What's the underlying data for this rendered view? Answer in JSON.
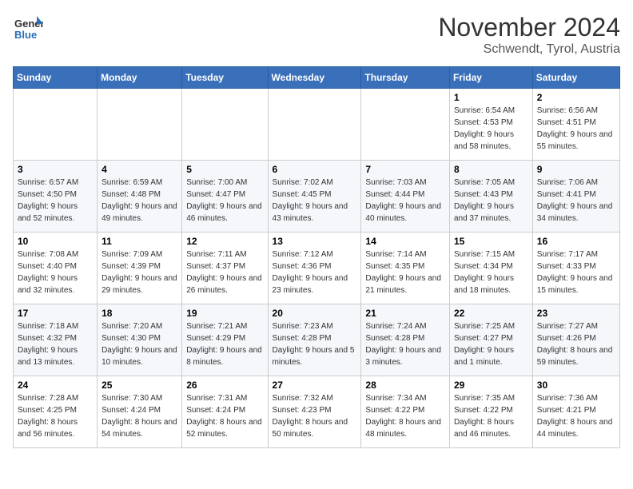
{
  "logo": {
    "general": "General",
    "blue": "Blue"
  },
  "header": {
    "month": "November 2024",
    "location": "Schwendt, Tyrol, Austria"
  },
  "weekdays": [
    "Sunday",
    "Monday",
    "Tuesday",
    "Wednesday",
    "Thursday",
    "Friday",
    "Saturday"
  ],
  "weeks": [
    [
      {
        "day": "",
        "info": ""
      },
      {
        "day": "",
        "info": ""
      },
      {
        "day": "",
        "info": ""
      },
      {
        "day": "",
        "info": ""
      },
      {
        "day": "",
        "info": ""
      },
      {
        "day": "1",
        "info": "Sunrise: 6:54 AM\nSunset: 4:53 PM\nDaylight: 9 hours and 58 minutes."
      },
      {
        "day": "2",
        "info": "Sunrise: 6:56 AM\nSunset: 4:51 PM\nDaylight: 9 hours and 55 minutes."
      }
    ],
    [
      {
        "day": "3",
        "info": "Sunrise: 6:57 AM\nSunset: 4:50 PM\nDaylight: 9 hours and 52 minutes."
      },
      {
        "day": "4",
        "info": "Sunrise: 6:59 AM\nSunset: 4:48 PM\nDaylight: 9 hours and 49 minutes."
      },
      {
        "day": "5",
        "info": "Sunrise: 7:00 AM\nSunset: 4:47 PM\nDaylight: 9 hours and 46 minutes."
      },
      {
        "day": "6",
        "info": "Sunrise: 7:02 AM\nSunset: 4:45 PM\nDaylight: 9 hours and 43 minutes."
      },
      {
        "day": "7",
        "info": "Sunrise: 7:03 AM\nSunset: 4:44 PM\nDaylight: 9 hours and 40 minutes."
      },
      {
        "day": "8",
        "info": "Sunrise: 7:05 AM\nSunset: 4:43 PM\nDaylight: 9 hours and 37 minutes."
      },
      {
        "day": "9",
        "info": "Sunrise: 7:06 AM\nSunset: 4:41 PM\nDaylight: 9 hours and 34 minutes."
      }
    ],
    [
      {
        "day": "10",
        "info": "Sunrise: 7:08 AM\nSunset: 4:40 PM\nDaylight: 9 hours and 32 minutes."
      },
      {
        "day": "11",
        "info": "Sunrise: 7:09 AM\nSunset: 4:39 PM\nDaylight: 9 hours and 29 minutes."
      },
      {
        "day": "12",
        "info": "Sunrise: 7:11 AM\nSunset: 4:37 PM\nDaylight: 9 hours and 26 minutes."
      },
      {
        "day": "13",
        "info": "Sunrise: 7:12 AM\nSunset: 4:36 PM\nDaylight: 9 hours and 23 minutes."
      },
      {
        "day": "14",
        "info": "Sunrise: 7:14 AM\nSunset: 4:35 PM\nDaylight: 9 hours and 21 minutes."
      },
      {
        "day": "15",
        "info": "Sunrise: 7:15 AM\nSunset: 4:34 PM\nDaylight: 9 hours and 18 minutes."
      },
      {
        "day": "16",
        "info": "Sunrise: 7:17 AM\nSunset: 4:33 PM\nDaylight: 9 hours and 15 minutes."
      }
    ],
    [
      {
        "day": "17",
        "info": "Sunrise: 7:18 AM\nSunset: 4:32 PM\nDaylight: 9 hours and 13 minutes."
      },
      {
        "day": "18",
        "info": "Sunrise: 7:20 AM\nSunset: 4:30 PM\nDaylight: 9 hours and 10 minutes."
      },
      {
        "day": "19",
        "info": "Sunrise: 7:21 AM\nSunset: 4:29 PM\nDaylight: 9 hours and 8 minutes."
      },
      {
        "day": "20",
        "info": "Sunrise: 7:23 AM\nSunset: 4:28 PM\nDaylight: 9 hours and 5 minutes."
      },
      {
        "day": "21",
        "info": "Sunrise: 7:24 AM\nSunset: 4:28 PM\nDaylight: 9 hours and 3 minutes."
      },
      {
        "day": "22",
        "info": "Sunrise: 7:25 AM\nSunset: 4:27 PM\nDaylight: 9 hours and 1 minute."
      },
      {
        "day": "23",
        "info": "Sunrise: 7:27 AM\nSunset: 4:26 PM\nDaylight: 8 hours and 59 minutes."
      }
    ],
    [
      {
        "day": "24",
        "info": "Sunrise: 7:28 AM\nSunset: 4:25 PM\nDaylight: 8 hours and 56 minutes."
      },
      {
        "day": "25",
        "info": "Sunrise: 7:30 AM\nSunset: 4:24 PM\nDaylight: 8 hours and 54 minutes."
      },
      {
        "day": "26",
        "info": "Sunrise: 7:31 AM\nSunset: 4:24 PM\nDaylight: 8 hours and 52 minutes."
      },
      {
        "day": "27",
        "info": "Sunrise: 7:32 AM\nSunset: 4:23 PM\nDaylight: 8 hours and 50 minutes."
      },
      {
        "day": "28",
        "info": "Sunrise: 7:34 AM\nSunset: 4:22 PM\nDaylight: 8 hours and 48 minutes."
      },
      {
        "day": "29",
        "info": "Sunrise: 7:35 AM\nSunset: 4:22 PM\nDaylight: 8 hours and 46 minutes."
      },
      {
        "day": "30",
        "info": "Sunrise: 7:36 AM\nSunset: 4:21 PM\nDaylight: 8 hours and 44 minutes."
      }
    ]
  ]
}
